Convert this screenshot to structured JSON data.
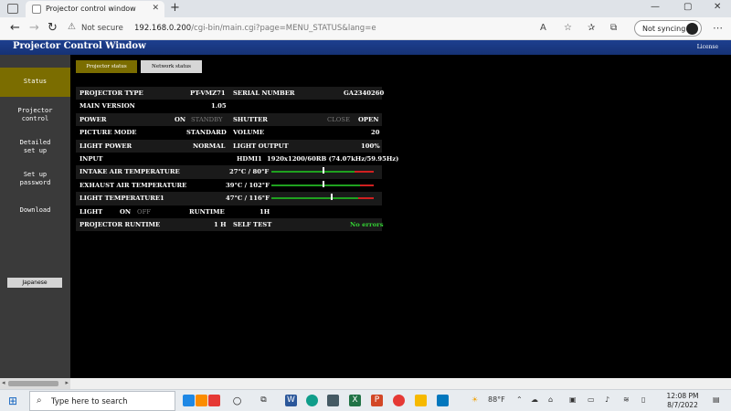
{
  "browser": {
    "tab_title": "Projector control window",
    "not_secure": "Not secure",
    "url_host": "192.168.0.200",
    "url_rest": "/cgi-bin/main.cgi?page=MENU_STATUS&lang=e",
    "sync_label": "Not syncing"
  },
  "page": {
    "title": "Projector Control Window",
    "license_link": "License"
  },
  "sidebar": {
    "items": [
      {
        "label": "Status"
      },
      {
        "line1": "Projector",
        "line2": "control"
      },
      {
        "line1": "Detailed",
        "line2": "set up"
      },
      {
        "line1": "Set up",
        "line2": "password"
      },
      {
        "label": "Download"
      }
    ],
    "language_button": "Japanese"
  },
  "subtabs": {
    "projector_status": "Projector status",
    "network_status": "Network status"
  },
  "status": {
    "projector_type_label": "PROJECTOR TYPE",
    "projector_type": "PT-VMZ71",
    "serial_label": "SERIAL NUMBER",
    "serial": "GA2340260",
    "main_version_label": "MAIN VERSION",
    "main_version": "1.05",
    "power_label": "POWER",
    "power_on": "ON",
    "power_standby": "STANDBY",
    "shutter_label": "SHUTTER",
    "shutter_close": "CLOSE",
    "shutter_open": "OPEN",
    "picture_mode_label": "PICTURE MODE",
    "picture_mode": "STANDARD",
    "volume_label": "VOLUME",
    "volume": "20",
    "light_power_label": "LIGHT POWER",
    "light_power": "NORMAL",
    "light_output_label": "LIGHT OUTPUT",
    "light_output": "100%",
    "input_label": "INPUT",
    "input": "HDMI1",
    "input_signal": "1920x1200/60RB (74.07kHz/59.95Hz)",
    "intake_label": "INTAKE AIR TEMPERATURE",
    "intake": "27°C / 80°F",
    "exhaust_label": "EXHAUST AIR TEMPERATURE",
    "exhaust": "39°C / 102°F",
    "light_temp_label": "LIGHT TEMPERATURE1",
    "light_temp": "47°C / 116°F",
    "light_label": "LIGHT",
    "light_on": "ON",
    "light_off": "OFF",
    "runtime_label": "RUNTIME",
    "runtime": "1H",
    "projector_runtime_label": "PROJECTOR RUNTIME",
    "projector_runtime": "1 H",
    "self_test_label": "SELF TEST",
    "self_test": "No errors",
    "gauges": {
      "intake_fraction": 0.5,
      "exhaust_fraction": 0.5,
      "light_fraction": 0.58
    },
    "colors": {
      "ok": "#34d234",
      "gauge_green": "#1fa11f",
      "gauge_red": "#d02020",
      "accent": "#7b6d00",
      "header_blue": "#1d3f8f"
    }
  },
  "taskbar": {
    "search_placeholder": "Type here to search",
    "weather": "88°F",
    "time": "12:08 PM",
    "date": "8/7/2022"
  }
}
